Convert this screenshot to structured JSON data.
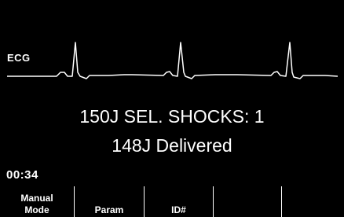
{
  "ecg": {
    "lead_label": "ECG"
  },
  "message": {
    "line1": "150J SEL. SHOCKS: 1",
    "line2": "148J Delivered"
  },
  "timer": "00:34",
  "softkeys": [
    {
      "line1": "Manual",
      "line2": "Mode"
    },
    {
      "line1": "",
      "line2": "Param"
    },
    {
      "line1": "",
      "line2": "ID#"
    },
    {
      "line1": "",
      "line2": ""
    },
    {
      "line1": "",
      "line2": ""
    }
  ],
  "colors": {
    "background": "#000000",
    "foreground": "#ffffff"
  }
}
